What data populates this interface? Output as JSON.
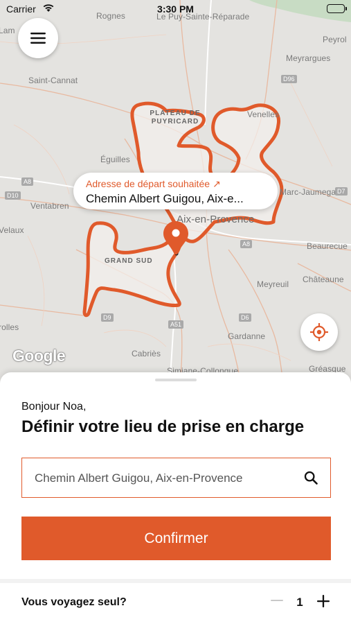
{
  "status_bar": {
    "carrier": "Carrier",
    "time": "3:30 PM"
  },
  "map": {
    "places": {
      "rognes": "Rognes",
      "le_puy": "Le Puy-Sainte-Réparade",
      "peyrolles": "Peyrol",
      "lambesc": "Lam",
      "meyrargues": "Meyrargues",
      "saint_cannat": "Saint-Cannat",
      "venelles": "Venelles",
      "eguilles": "Éguilles",
      "ventabren": "Ventabren",
      "marc_jaumegarde": "Marc-Jaumegar",
      "velaux": "Velaux",
      "aix": "Aix-en-Provence",
      "beaurecueil": "Beaurecue",
      "meyreuil": "Meyreuil",
      "chateauneuf": "Châteaune",
      "rolles": "rolles",
      "gardanne": "Gardanne",
      "cabries": "Cabriès",
      "simiane": "Simiane-Collongue",
      "greasque": "Gréasque"
    },
    "zones": {
      "plateau": "PLATEAU DE PUYRICARD",
      "grand_sud": "GRAND SUD"
    },
    "roads": {
      "d96": "D96",
      "a8_left": "A8",
      "d10": "D10",
      "a8_center": "A8",
      "d9": "D9",
      "a51": "A51",
      "d6": "D6",
      "d7": "D7"
    },
    "google": "Google",
    "zone_color": "#e05a2b"
  },
  "callout": {
    "label": "Adresse de départ souhaitée",
    "arrow": "↗",
    "address": "Chemin Albert Guigou, Aix-e..."
  },
  "sheet": {
    "greeting": "Bonjour Noa,",
    "title": "Définir votre lieu de prise en charge",
    "search_value": "Chemin Albert Guigou, Aix-en-Provence",
    "confirm_label": "Confirmer",
    "travel_label": "Vous voyagez seul?",
    "passenger_count": "1",
    "accent_color": "#e05a2b"
  },
  "icons": {
    "menu": "hamburger-menu-icon",
    "locate": "crosshair-icon",
    "search": "magnifier-icon",
    "minus": "minus-icon",
    "plus": "plus-icon",
    "pin": "map-pin-icon"
  }
}
